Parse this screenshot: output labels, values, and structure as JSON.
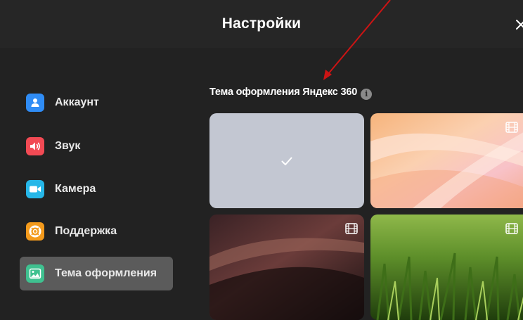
{
  "header": {
    "title": "Настройки",
    "close_label": "✕"
  },
  "sidebar": {
    "items": [
      {
        "label": "Аккаунт",
        "icon": "user-icon",
        "color": "#2f8cf5",
        "active": false
      },
      {
        "label": "Звук",
        "icon": "speaker-icon",
        "color": "#f24a54",
        "active": false
      },
      {
        "label": "Камера",
        "icon": "video-camera-icon",
        "color": "#26b7e8",
        "active": false
      },
      {
        "label": "Поддержка",
        "icon": "lifebuoy-icon",
        "color": "#f39a1c",
        "active": false
      },
      {
        "label": "Тема оформления",
        "icon": "image-icon",
        "color": "#3fc190",
        "active": true
      }
    ]
  },
  "theme": {
    "title": "Тема оформления Яндекс 360",
    "info_icon": "info-icon",
    "tiles": [
      {
        "name": "plain-gray",
        "selected": true,
        "animated": false,
        "color": "#c3c7d2"
      },
      {
        "name": "peach-waves",
        "selected": false,
        "animated": true
      },
      {
        "name": "dark-silk",
        "selected": false,
        "animated": true
      },
      {
        "name": "green-grass",
        "selected": false,
        "animated": true
      }
    ]
  },
  "colors": {
    "background": "#222222",
    "header": "#262626",
    "active_item": "#5b5b5b",
    "annotation_arrow": "#cc1414"
  }
}
